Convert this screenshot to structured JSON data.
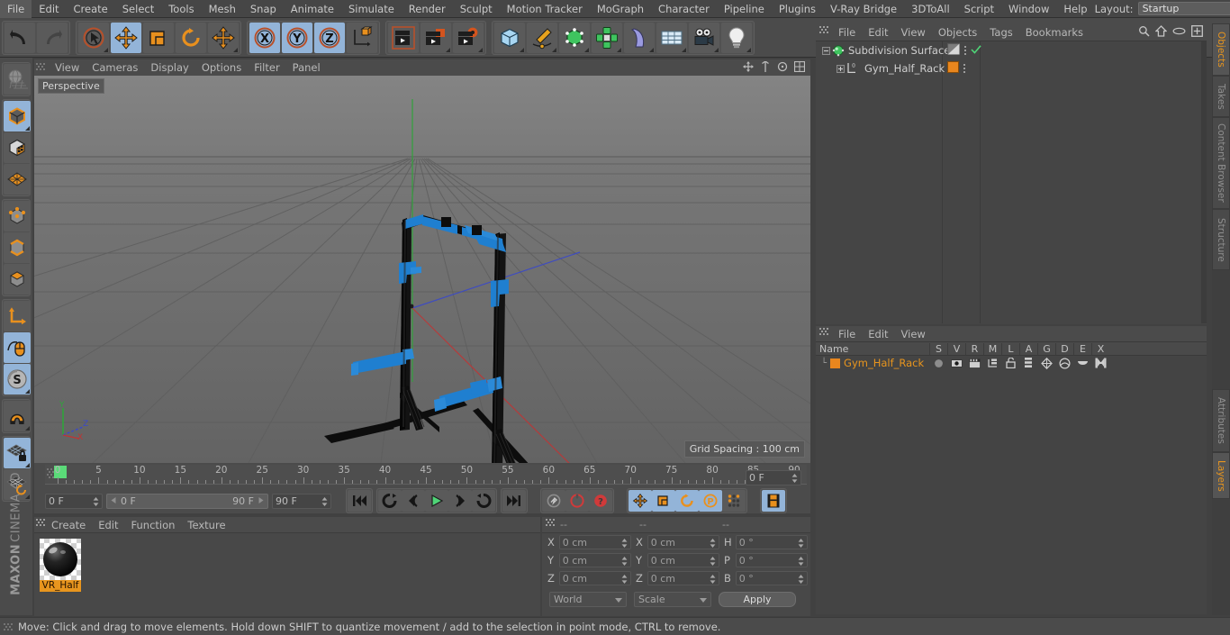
{
  "menubar": {
    "items": [
      "File",
      "Edit",
      "Create",
      "Select",
      "Tools",
      "Mesh",
      "Snap",
      "Animate",
      "Simulate",
      "Render",
      "Sculpt",
      "Motion Tracker",
      "MoGraph",
      "Character",
      "Pipeline",
      "Plugins",
      "V-Ray Bridge",
      "3DToAll",
      "Script",
      "Window",
      "Help"
    ],
    "layout_label": "Layout:",
    "layout_value": "Startup",
    "search_icon": "search-icon"
  },
  "toolbar": {
    "groups": [
      {
        "name": "history",
        "buttons": [
          {
            "name": "undo",
            "icon": "undo-arrow-icon",
            "active": false
          },
          {
            "name": "redo",
            "icon": "redo-arrow-icon",
            "active": false
          }
        ]
      },
      {
        "name": "tools",
        "buttons": [
          {
            "name": "live-selection",
            "icon": "cursor-circle-icon",
            "active": false
          },
          {
            "name": "move",
            "icon": "move-arrows-icon",
            "active": true
          },
          {
            "name": "scale",
            "icon": "scale-box-icon",
            "active": false
          },
          {
            "name": "rotate",
            "icon": "rotate-circle-icon",
            "active": false
          },
          {
            "name": "move-tool-dup",
            "icon": "move-arrows-icon",
            "active": false
          }
        ]
      },
      {
        "name": "axis-locks",
        "buttons": [
          {
            "name": "lock-x",
            "icon": "axis-x-icon",
            "label": "X",
            "active": true
          },
          {
            "name": "lock-y",
            "icon": "axis-y-icon",
            "label": "Y",
            "active": true
          },
          {
            "name": "lock-z",
            "icon": "axis-z-icon",
            "label": "Z",
            "active": true
          },
          {
            "name": "world-object-coord",
            "icon": "world-axis-cube-icon",
            "active": false
          }
        ]
      },
      {
        "name": "render",
        "buttons": [
          {
            "name": "render-view",
            "icon": "clapper-view-icon",
            "active": false
          },
          {
            "name": "render-to-picture-viewer",
            "icon": "clapper-picture-icon",
            "active": false
          },
          {
            "name": "render-settings",
            "icon": "clapper-gear-icon",
            "active": false
          }
        ]
      },
      {
        "name": "create",
        "buttons": [
          {
            "name": "add-cube",
            "icon": "cube-blue-icon",
            "active": false
          },
          {
            "name": "add-spline",
            "icon": "pen-spline-icon",
            "active": false
          },
          {
            "name": "add-nurbs",
            "icon": "green-cube-points-icon",
            "active": false
          },
          {
            "name": "add-array",
            "icon": "green-cluster-icon",
            "active": false
          },
          {
            "name": "add-deformer",
            "icon": "bend-deformer-icon",
            "active": false
          },
          {
            "name": "add-scene-object",
            "icon": "floor-grid-icon",
            "active": false
          },
          {
            "name": "add-camera",
            "icon": "camera-icon",
            "active": false
          },
          {
            "name": "add-light",
            "icon": "lightbulb-icon",
            "active": false
          }
        ]
      }
    ]
  },
  "left_toolbar": {
    "buttons": [
      {
        "name": "undo-view",
        "icon": "globe-wire-icon",
        "active": false
      },
      {
        "name": "model-mode",
        "icon": "orange-cube-icon",
        "active": true
      },
      {
        "name": "texture-mode",
        "icon": "checker-cube-icon",
        "active": false
      },
      {
        "name": "workplane-mode",
        "icon": "orange-grid-plane-icon",
        "active": false
      },
      {
        "name": "point-mode",
        "icon": "point-cube-icon",
        "active": false
      },
      {
        "name": "edge-mode",
        "icon": "edge-cube-icon",
        "active": false
      },
      {
        "name": "polygon-mode",
        "icon": "polygon-cube-icon",
        "active": false
      },
      {
        "name": "axis-modify",
        "icon": "axis-L-icon",
        "active": false
      },
      {
        "name": "enable-snapping",
        "icon": "mouse-spline-icon",
        "active": true
      },
      {
        "name": "soft-selection",
        "icon": "s-disc-icon",
        "active": true
      },
      {
        "name": "magnet-tool",
        "icon": "magnet-icon",
        "active": false
      },
      {
        "name": "workplane-lock",
        "icon": "grid-lock-icon",
        "active": true
      },
      {
        "name": "workplane-rotate",
        "icon": "grid-rotate-icon",
        "active": false
      }
    ],
    "brand_bold": "MAXON",
    "brand_rest": "CINEMA 4D"
  },
  "viewport": {
    "menu": [
      "View",
      "Cameras",
      "Display",
      "Options",
      "Filter",
      "Panel"
    ],
    "label": "Perspective",
    "grid_spacing": "Grid Spacing : 100 cm",
    "axis_labels": {
      "x": "X",
      "y": "Y",
      "z": "Z"
    },
    "model_name": "Gym_Half_Rack",
    "colors": {
      "model_dark": "#0d0d0d",
      "model_blue": "#1f7fd0",
      "bg_top": "#7b7b7b",
      "bg_bottom": "#6a6a6a",
      "grid_line": "#5d5d5d",
      "axis_x": "#c03434",
      "axis_y": "#2fa33a",
      "axis_z": "#3a49c8"
    }
  },
  "timeline": {
    "marks": [
      "0",
      "5",
      "10",
      "15",
      "20",
      "25",
      "30",
      "35",
      "40",
      "45",
      "50",
      "55",
      "60",
      "65",
      "70",
      "75",
      "80",
      "85",
      "90"
    ],
    "current_frame": "0 F",
    "range_start": "0 F",
    "range_end": "90 F",
    "max_frame": "90 F",
    "preview_frame": "0 F",
    "transport": [
      {
        "name": "go-to-start",
        "icon": "skip-start-icon"
      },
      {
        "name": "play-backwards-loop",
        "icon": "loop-back-icon"
      },
      {
        "name": "previous-frame",
        "icon": "prev-frame-icon"
      },
      {
        "name": "play",
        "icon": "play-icon",
        "active": false
      },
      {
        "name": "next-frame",
        "icon": "next-frame-icon"
      },
      {
        "name": "play-forwards-loop",
        "icon": "loop-forward-icon"
      },
      {
        "name": "go-to-end",
        "icon": "skip-end-icon"
      }
    ],
    "record_group": [
      {
        "name": "autokeying",
        "icon": "key-icon"
      },
      {
        "name": "record-active-objects",
        "icon": "record-icon"
      },
      {
        "name": "keyframe-selection",
        "icon": "question-record-icon"
      }
    ],
    "key_group": [
      {
        "name": "record-position",
        "icon": "move-arrows-icon",
        "active": true
      },
      {
        "name": "record-scale",
        "icon": "scale-box-icon",
        "active": true
      },
      {
        "name": "record-rotation",
        "icon": "rotate-circle-icon",
        "active": true
      },
      {
        "name": "record-parameter",
        "icon": "param-p-icon",
        "active": true
      },
      {
        "name": "record-pla",
        "icon": "dots-grid-icon",
        "active": false
      }
    ],
    "timeline_toggle": {
      "name": "timeline-filmstrip",
      "icon": "filmstrip-icon",
      "active": true
    }
  },
  "material_manager": {
    "menu": [
      "Create",
      "Edit",
      "Function",
      "Texture"
    ],
    "materials": [
      {
        "name": "VR_Half",
        "selected": true
      }
    ]
  },
  "coordinates": {
    "headers": [
      "--",
      "--",
      "--"
    ],
    "rows": [
      {
        "pos_label": "X",
        "pos_value": "0 cm",
        "size_label": "X",
        "size_value": "0 cm",
        "rot_label": "H",
        "rot_value": "0 °"
      },
      {
        "pos_label": "Y",
        "pos_value": "0 cm",
        "size_label": "Y",
        "size_value": "0 cm",
        "rot_label": "P",
        "rot_value": "0 °"
      },
      {
        "pos_label": "Z",
        "pos_value": "0 cm",
        "size_label": "Z",
        "size_value": "0 cm",
        "rot_label": "B",
        "rot_value": "0 °"
      }
    ],
    "system": "World",
    "mode": "Scale",
    "apply_label": "Apply"
  },
  "object_manager": {
    "menu": [
      "File",
      "Edit",
      "View",
      "Objects",
      "Tags",
      "Bookmarks"
    ],
    "header_icons": [
      "search-icon",
      "home-icon",
      "ellipse-icon",
      "plus-box-icon"
    ],
    "items": [
      {
        "name": "Subdivision Surface",
        "icon": "subdivision-surface-icon",
        "indent": 0,
        "expander": "minus",
        "tag_icons": [
          "display-tag-icon",
          "dots-icon",
          "green-check-icon"
        ]
      },
      {
        "name": "Gym_Half_Rack",
        "icon": "null-L0-icon",
        "indent": 1,
        "expander": "plus",
        "tag_icons": [
          "orange-material-tag-icon",
          "dots-icon"
        ]
      }
    ]
  },
  "layer_manager": {
    "menu": [
      "File",
      "Edit",
      "View"
    ],
    "columns": [
      "Name",
      "S",
      "V",
      "R",
      "M",
      "L",
      "A",
      "G",
      "D",
      "E",
      "X"
    ],
    "rows": [
      {
        "name": "Gym_Half_Rack",
        "color": "#e8861e",
        "cells": [
          "solo-dot-icon",
          "eye-icon",
          "render-clapper-icon",
          "manager-icon",
          "lock-open-icon",
          "animation-icon",
          "generator-icon",
          "deformer-icon",
          "expression-icon",
          "xref-icon"
        ]
      }
    ]
  },
  "right_tabs": {
    "top": [
      "Objects",
      "Takes",
      "Content Browser",
      "Structure"
    ],
    "bottom": [
      "Attributes",
      "Layers"
    ],
    "active_top": "Objects",
    "active_bottom": "Layers"
  },
  "status_bar": {
    "message": "Move: Click and drag to move elements. Hold down SHIFT to quantize movement / add to the selection in point mode, CTRL to remove."
  }
}
